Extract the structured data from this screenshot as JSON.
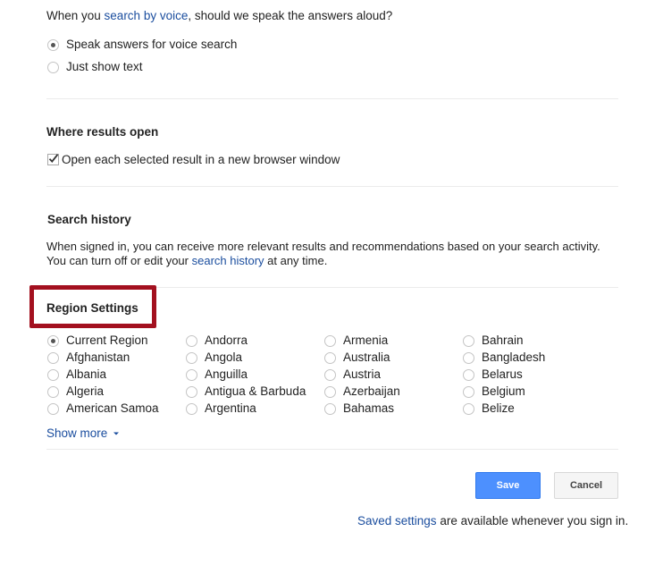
{
  "voice": {
    "question_before": "When you ",
    "question_link": "search by voice",
    "question_after": ", should we speak the answers aloud?",
    "options": [
      "Speak answers for voice search",
      "Just show text"
    ],
    "selected": 0
  },
  "results_open": {
    "title": "Where results open",
    "checkbox_label": "Open each selected result in a new browser window",
    "checked": true
  },
  "history": {
    "title": "Search history",
    "line1": "When signed in, you can receive more relevant results and recommendations based on your search activity.",
    "line2_before": "You can turn off or edit your ",
    "line2_link": "search history",
    "line2_after": " at any time."
  },
  "region": {
    "title": "Region Settings",
    "columns": [
      [
        "Current Region",
        "Afghanistan",
        "Albania",
        "Algeria",
        "American Samoa"
      ],
      [
        "Andorra",
        "Angola",
        "Anguilla",
        "Antigua & Barbuda",
        "Argentina"
      ],
      [
        "Armenia",
        "Australia",
        "Austria",
        "Azerbaijan",
        "Bahamas"
      ],
      [
        "Bahrain",
        "Bangladesh",
        "Belarus",
        "Belgium",
        "Belize"
      ]
    ],
    "selected": "Current Region",
    "show_more": "Show more"
  },
  "buttons": {
    "save": "Save",
    "cancel": "Cancel"
  },
  "footer": {
    "link": "Saved settings",
    "text": " are available whenever you sign in."
  },
  "colors": {
    "link": "#1a4d9e",
    "save_button": "#4d90fe",
    "highlight_border": "#a3101f"
  },
  "icons": {
    "dropdown": "caret-down-icon",
    "check": "check-icon"
  }
}
